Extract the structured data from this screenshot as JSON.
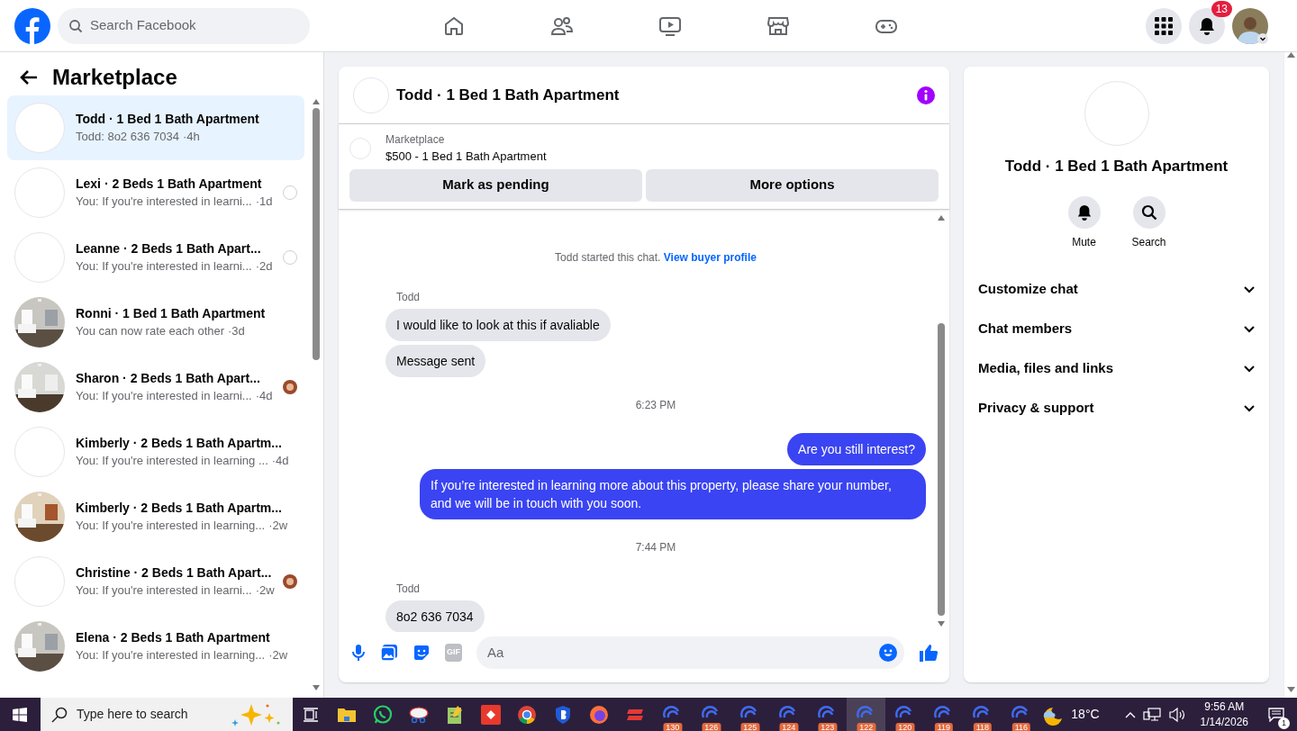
{
  "topbar": {
    "search_placeholder": "Search Facebook",
    "notifications_badge": "13"
  },
  "sidebar": {
    "title": "Marketplace",
    "conversations": [
      {
        "title": "Todd · 1 Bed 1 Bath Apartment",
        "preview": "Todd: 8o2 636 7034",
        "time": "·4h",
        "photo": false,
        "unread_circle": false,
        "seen_avatar": false,
        "selected": true
      },
      {
        "title": "Lexi · 2 Beds 1 Bath Apartment",
        "preview": "You: If you're interested in learni...",
        "time": "·1d",
        "photo": false,
        "unread_circle": true,
        "seen_avatar": false,
        "selected": false
      },
      {
        "title": "Leanne · 2 Beds 1 Bath Apart...",
        "preview": "You: If you're interested in learni...",
        "time": "·2d",
        "photo": false,
        "unread_circle": true,
        "seen_avatar": false,
        "selected": false
      },
      {
        "title": "Ronni · 1 Bed 1 Bath Apartment",
        "preview": "You can now rate each other",
        "time": "·3d",
        "photo": true,
        "unread_circle": false,
        "seen_avatar": false,
        "selected": false
      },
      {
        "title": "Sharon · 2 Beds 1 Bath Apart...",
        "preview": "You: If you're interested in learni...",
        "time": "·4d",
        "photo": true,
        "unread_circle": false,
        "seen_avatar": true,
        "selected": false
      },
      {
        "title": "Kimberly · 2 Beds 1 Bath Apartm...",
        "preview": "You: If you're interested in learning ...",
        "time": "·4d",
        "photo": false,
        "unread_circle": false,
        "seen_avatar": false,
        "selected": false
      },
      {
        "title": "Kimberly · 2 Beds 1 Bath Apartm...",
        "preview": "You: If you're interested in learning...",
        "time": "·2w",
        "photo": true,
        "unread_circle": false,
        "seen_avatar": false,
        "selected": false
      },
      {
        "title": "Christine · 2 Beds 1 Bath Apart...",
        "preview": "You: If you're interested in learni...",
        "time": "·2w",
        "photo": false,
        "unread_circle": false,
        "seen_avatar": true,
        "selected": false
      },
      {
        "title": "Elena · 2 Beds 1 Bath Apartment",
        "preview": "You: If you're interested in learning...",
        "time": "·2w",
        "photo": true,
        "unread_circle": false,
        "seen_avatar": false,
        "selected": false
      }
    ]
  },
  "chat": {
    "title": "Todd · 1 Bed 1 Bath Apartment",
    "listing": {
      "label": "Marketplace",
      "title": "$500 - 1 Bed 1 Bath Apartment"
    },
    "buttons": [
      "Mark as pending",
      "More options"
    ],
    "messages": [
      {
        "kind": "system",
        "text": "Todd started this chat.",
        "link": "View buyer profile"
      },
      {
        "kind": "sender",
        "text": "Todd"
      },
      {
        "kind": "incoming",
        "text": "I would  like to look at this if avaliable"
      },
      {
        "kind": "incoming",
        "text": "Message sent"
      },
      {
        "kind": "timestamp",
        "text": "6:23 PM"
      },
      {
        "kind": "outgoing",
        "text": "Are you still interest?"
      },
      {
        "kind": "outgoing",
        "text": "If you’re interested in learning more about this property, please share your number, and we will be in touch with you soon."
      },
      {
        "kind": "timestamp",
        "text": "7:44 PM"
      },
      {
        "kind": "sender",
        "text": "Todd"
      },
      {
        "kind": "incoming",
        "text": "8o2 636 7034"
      }
    ],
    "composer_placeholder": "Aa",
    "gif_label": "GIF"
  },
  "info": {
    "title": "Todd · 1 Bed 1 Bath Apartment",
    "actions": [
      {
        "kind": "bell",
        "label": "Mute"
      },
      {
        "kind": "search",
        "label": "Search"
      }
    ],
    "sections": [
      "Customize chat",
      "Chat members",
      "Media, files and links",
      "Privacy & support"
    ]
  },
  "taskbar": {
    "search_placeholder": "Type here to search",
    "counters": [
      {
        "label": "130",
        "selected": false
      },
      {
        "label": "126",
        "selected": false
      },
      {
        "label": "125",
        "selected": false
      },
      {
        "label": "124",
        "selected": false
      },
      {
        "label": "123",
        "selected": false
      },
      {
        "label": "122",
        "selected": true
      },
      {
        "label": "120",
        "selected": false
      },
      {
        "label": "119",
        "selected": false
      },
      {
        "label": "118",
        "selected": false
      },
      {
        "label": "116",
        "selected": false
      }
    ],
    "temperature": "18°C",
    "time": "9:56 AM",
    "date": "1/14/2026",
    "notifications": "1"
  }
}
